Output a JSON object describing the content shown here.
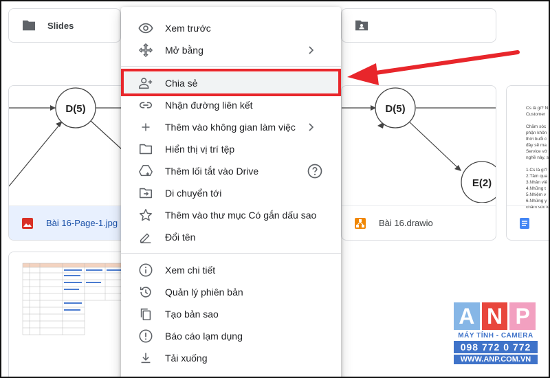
{
  "folders": [
    {
      "name": "Slides",
      "icon": "folder-icon"
    },
    {
      "name": "",
      "icon": "shared-folder-icon"
    }
  ],
  "files": [
    {
      "name": "Bài 16-Page-1.jpg",
      "icon": "image-file-icon",
      "selected": true
    },
    {
      "name": "Bài 16.drawio",
      "icon": "drawio-file-icon"
    },
    {
      "name": "",
      "icon": "docs-file-icon"
    }
  ],
  "diagram": {
    "node1": "D(5)",
    "node2": "D(5)",
    "node3": "E(2)"
  },
  "doc_preview_lines": [
    "Cs là gì? N",
    "Customer",
    "Chăm sóc",
    "phận khôn",
    "thời buổi c",
    "đây sẽ ma",
    "Service vớ",
    "nghề này, s",
    "1.Cs là gì?",
    "2.Tầm qua",
    "3.Nhân viê",
    "4.Những t",
    "5.Nhiệm v",
    "6.Những y",
    "chăm sóc k"
  ],
  "menu": {
    "items": [
      {
        "label": "Xem trước",
        "icon": "eye-icon"
      },
      {
        "label": "Mở bằng",
        "icon": "move-arrows-icon",
        "submenu": true
      },
      {
        "label": "Chia sẻ",
        "icon": "person-add-icon",
        "highlighted": true
      },
      {
        "label": "Nhận đường liên kết",
        "icon": "link-icon"
      },
      {
        "label": "Thêm vào không gian làm việc",
        "icon": "plus-icon",
        "submenu": true
      },
      {
        "label": "Hiển thị vị trí tệp",
        "icon": "folder-outline-icon"
      },
      {
        "label": "Thêm lối tắt vào Drive",
        "icon": "drive-shortcut-icon",
        "help": true
      },
      {
        "label": "Di chuyển tới",
        "icon": "folder-move-icon"
      },
      {
        "label": "Thêm vào thư mục Có gắn dấu sao",
        "icon": "star-icon"
      },
      {
        "label": "Đổi tên",
        "icon": "pencil-icon"
      },
      {
        "label": "Xem chi tiết",
        "icon": "info-icon"
      },
      {
        "label": "Quản lý phiên bản",
        "icon": "history-icon"
      },
      {
        "label": "Tạo bản sao",
        "icon": "copy-icon"
      },
      {
        "label": "Báo cáo lạm dụng",
        "icon": "report-icon"
      },
      {
        "label": "Tải xuống",
        "icon": "download-icon"
      }
    ]
  },
  "watermark": {
    "letters": [
      "A",
      "N",
      "P"
    ],
    "tagline": "MÁY TÍNH - CAMERA",
    "phone": "098 772 0 772",
    "website": "WWW.ANP.COM.VN"
  },
  "colors": {
    "highlight_border": "#e8262b",
    "selected_bg": "#e8f0fe",
    "icon_gray": "#5f6368",
    "wm_a": "#86b6e6",
    "wm_n": "#e8463c",
    "wm_p": "#f2a0c0",
    "wm_blue": "#3f73c9"
  }
}
